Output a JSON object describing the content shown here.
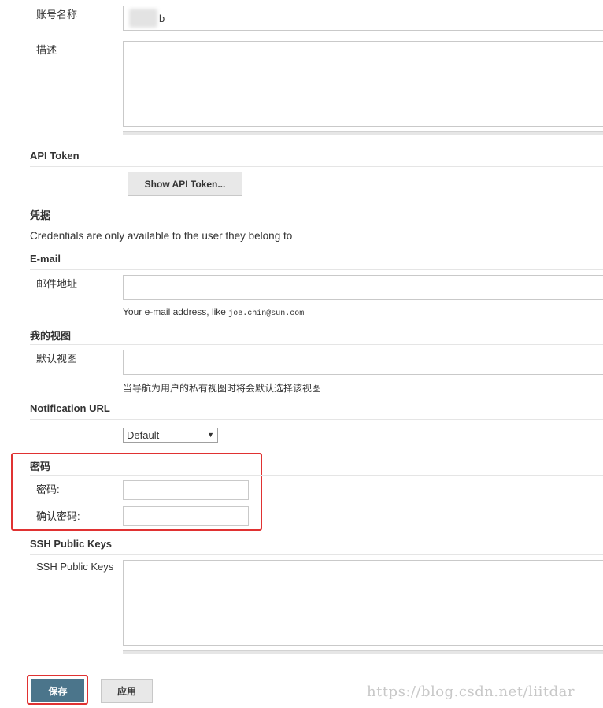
{
  "account": {
    "label": "账号名称",
    "value": "b"
  },
  "description": {
    "label": "描述",
    "value": ""
  },
  "api_token": {
    "heading": "API Token",
    "button": "Show API Token..."
  },
  "credentials": {
    "heading": "凭据",
    "text": "Credentials are only available to the user they belong to"
  },
  "email": {
    "heading": "E-mail",
    "label": "邮件地址",
    "value": "",
    "hint_prefix": "Your e-mail address, like ",
    "hint_example": "joe.chin@sun.com"
  },
  "my_views": {
    "heading": "我的视图",
    "label": "默认视图",
    "value": "",
    "hint": "当导航为用户的私有视图时将会默认选择该视图"
  },
  "notification": {
    "heading": "Notification URL",
    "selected": "Default"
  },
  "password": {
    "heading": "密码",
    "password_label": "密码:",
    "confirm_label": "确认密码:"
  },
  "ssh": {
    "heading": "SSH Public Keys",
    "label": "SSH Public Keys",
    "value": ""
  },
  "footer": {
    "save": "保存",
    "apply": "应用"
  },
  "watermark": "https://blog.csdn.net/liitdar",
  "colors": {
    "highlight": "#e03232",
    "primary": "#4b758b"
  }
}
